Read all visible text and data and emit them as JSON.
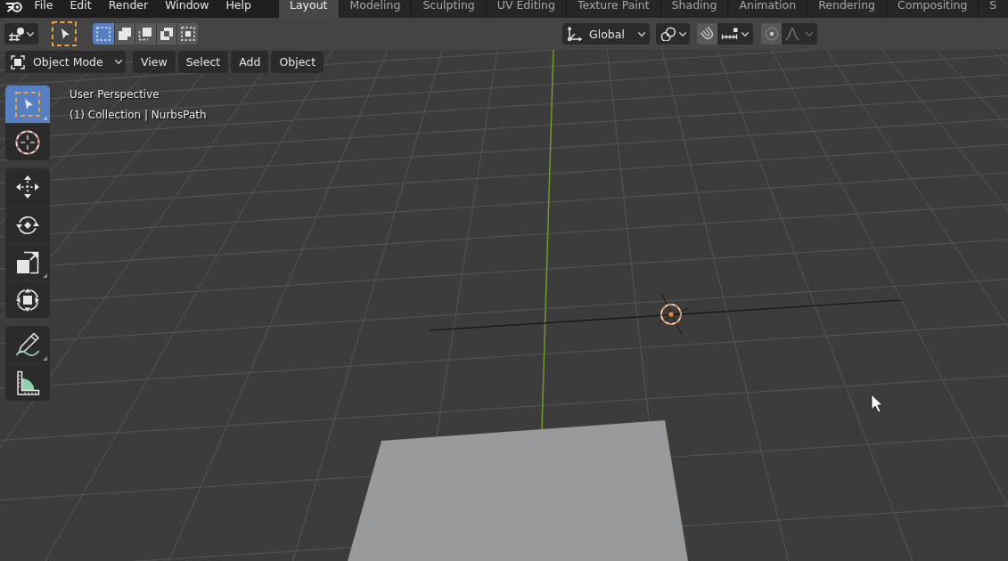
{
  "top_bar": {
    "menu": [
      "File",
      "Edit",
      "Render",
      "Window",
      "Help"
    ],
    "workspaces": [
      {
        "label": "Layout",
        "selected": true
      },
      {
        "label": "Modeling",
        "selected": false
      },
      {
        "label": "Sculpting",
        "selected": false
      },
      {
        "label": "UV Editing",
        "selected": false
      },
      {
        "label": "Texture Paint",
        "selected": false
      },
      {
        "label": "Shading",
        "selected": false
      },
      {
        "label": "Animation",
        "selected": false
      },
      {
        "label": "Rendering",
        "selected": false
      },
      {
        "label": "Compositing",
        "selected": false
      },
      {
        "label": "S",
        "selected": false
      }
    ]
  },
  "viewport": {
    "header": {
      "select_modes": [
        {
          "kind": "set",
          "selected": true
        },
        {
          "kind": "extend",
          "selected": false
        },
        {
          "kind": "subtract",
          "selected": false
        },
        {
          "kind": "difference",
          "selected": false
        },
        {
          "kind": "intersect",
          "selected": false
        }
      ],
      "orientation": "Global",
      "snap": {
        "on": false
      },
      "proportional_editing": {
        "on": false,
        "falloff": {
          "disabled": true
        }
      }
    },
    "mode": "Object Mode",
    "menus": [
      "View",
      "Select",
      "Add",
      "Object"
    ],
    "toolbar": [
      {
        "tools": [
          {
            "kind": "select_box",
            "selected": true,
            "flyout": true
          },
          {
            "kind": "cursor",
            "selected": false,
            "flyout": false
          }
        ]
      },
      {
        "tools": [
          {
            "kind": "move",
            "selected": false,
            "flyout": false
          },
          {
            "kind": "rotate",
            "selected": false,
            "flyout": false
          },
          {
            "kind": "scale",
            "selected": false,
            "flyout": true
          },
          {
            "kind": "transform",
            "selected": false,
            "flyout": false
          }
        ]
      },
      {
        "tools": [
          {
            "kind": "annotate",
            "selected": false,
            "flyout": true
          },
          {
            "kind": "measure",
            "selected": false,
            "flyout": false
          }
        ]
      }
    ],
    "overlay_text": [
      "User Perspective",
      "(1) Collection | NurbsPath"
    ]
  }
}
